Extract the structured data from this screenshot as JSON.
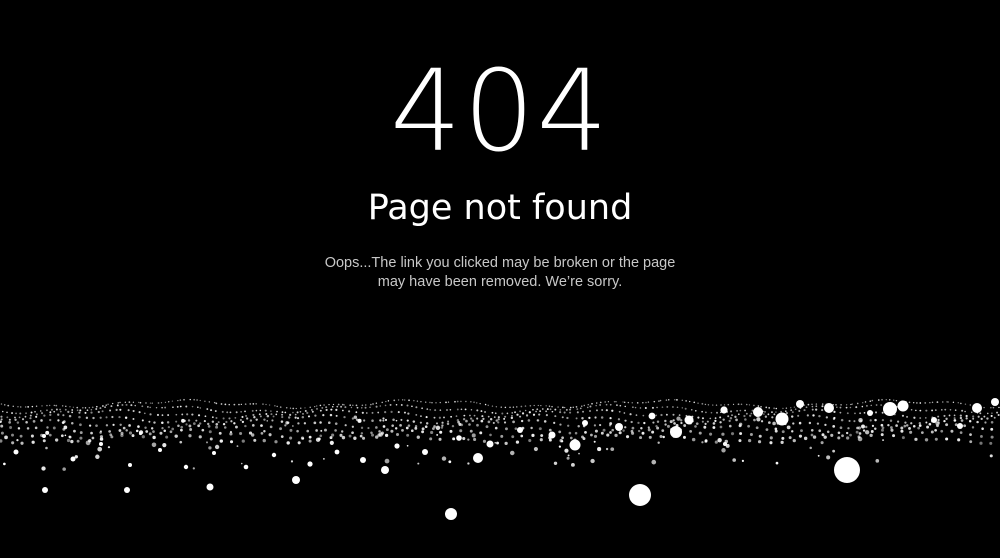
{
  "error": {
    "code": "404",
    "title": "Page not found",
    "message_line1": "Oops...The link you clicked may be broken or the page",
    "message_line2": "may have been removed. We’re sorry."
  },
  "colors": {
    "background": "#000000",
    "text": "#ffffff",
    "muted_text": "#c8c8c8",
    "particles": "#ffffff"
  }
}
